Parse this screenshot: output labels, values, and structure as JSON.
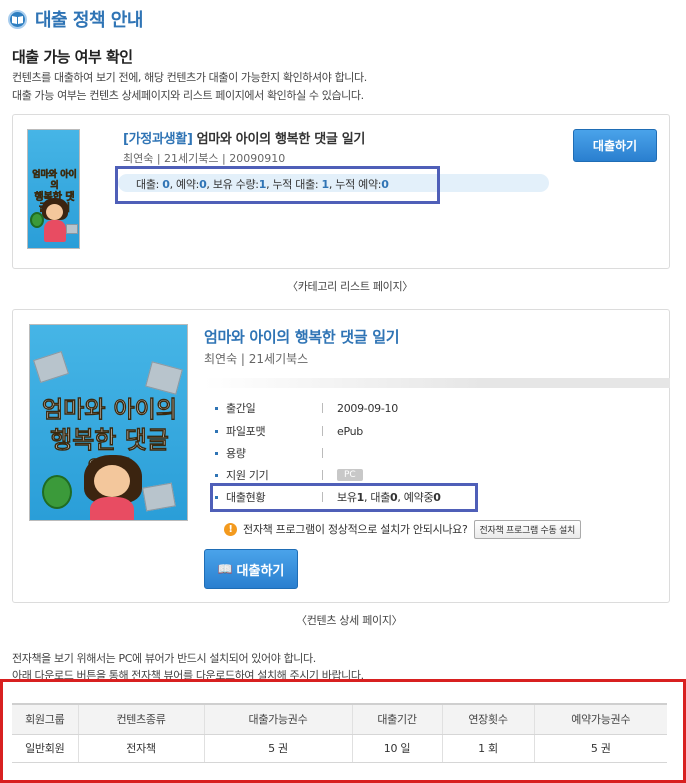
{
  "page_title": "대출 정책 안내",
  "section_title": "대출 가능 여부 확인",
  "intro": [
    "컨텐츠를 대출하여 보기 전에, 해당 컨텐츠가 대출이 가능한지 확인하셔야 합니다.",
    "대출 가능 여부는 컨텐츠 상세페이지와 리스트 페이지에서 확인하실 수 있습니다."
  ],
  "list_card": {
    "category": "[가정과생활]",
    "title": "엄마와 아이의 행복한 댓글 일기",
    "meta": "최연숙 | 21세기북스 | 20090910",
    "status": {
      "loan_label": "대출: ",
      "loan": "0",
      "reserve_label": ", 예약:",
      "reserve": "0",
      "own_label": ", 보유 수량:",
      "own": "1",
      "total_loan_label": ", 누적 대출: ",
      "total_loan": "1",
      "total_reserve_label": ", 누적 예약:",
      "total_reserve": "0"
    },
    "borrow_button": "대출하기",
    "caption": "〈카테고리 리스트 페이지〉"
  },
  "cover": {
    "line1": "엄마와 아이의",
    "line2": "행복한 댓글 일기"
  },
  "detail_card": {
    "title": "엄마와 아이의 행복한 댓글 일기",
    "meta": "최연숙 | 21세기북스",
    "rows": [
      {
        "label": "출간일",
        "value": "2009-09-10"
      },
      {
        "label": "파일포맷",
        "value": "ePub"
      },
      {
        "label": "용량",
        "value": ""
      },
      {
        "label": "지원 기기",
        "value": "PC"
      },
      {
        "label": "대출현황",
        "value_parts": [
          "보유",
          "1",
          ", 대출",
          "0",
          ", 예약중",
          "0"
        ]
      }
    ],
    "warning": "전자책 프로그램이 정상적으로 설치가 안되시나요?",
    "install_button": "전자책 프로그램 수동 설치",
    "borrow_button": "대출하기",
    "caption": "〈컨텐츠 상세 페이지〉"
  },
  "notice": [
    "전자책을 보기 위해서는 PC에 뷰어가 반드시  설치되어 있어야  합니다.",
    "아래 다운로드 버튼을 통해 전자책 뷰어를 다운로드하여 설치해 주시기 바랍니다."
  ],
  "policy_table": {
    "headers": [
      "회원그룹",
      "컨텐츠종류",
      "대출가능권수",
      "대출기간",
      "연장횟수",
      "예약가능권수"
    ],
    "row": [
      "일반회원",
      "전자책",
      "5 권",
      "10 일",
      "1 회",
      "5 권"
    ]
  },
  "colors": {
    "accent_blue": "#2f74b5",
    "highlight_blue": "#4f5fb8",
    "highlight_red": "#d82020"
  }
}
